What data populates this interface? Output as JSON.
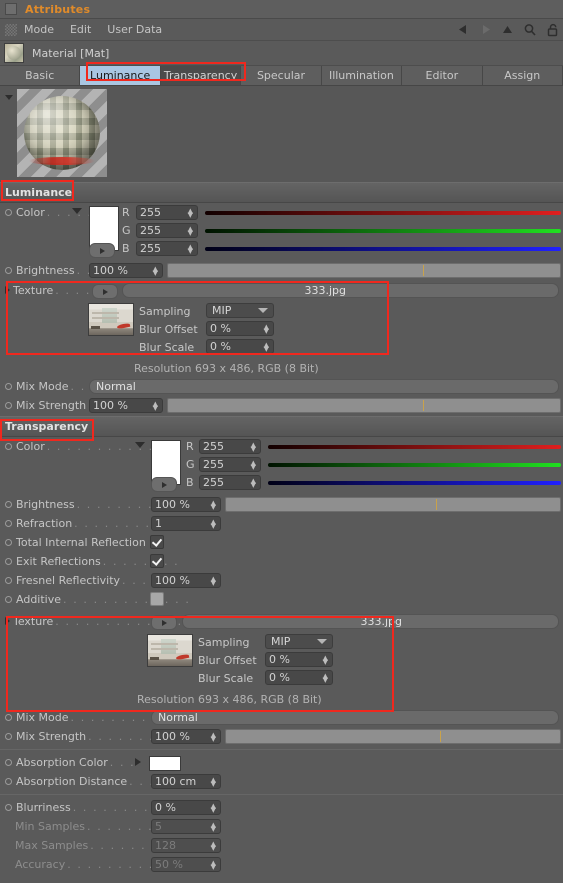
{
  "window": {
    "title": "Attributes",
    "menu": [
      "Mode",
      "Edit",
      "User Data"
    ],
    "toolbar_icons": [
      "prev-arrow-icon",
      "next-arrow-icon",
      "up-arrow-icon",
      "search-icon",
      "lock-icon"
    ]
  },
  "object": {
    "name": "Material [Mat]"
  },
  "tabs": [
    {
      "label": "Basic",
      "state": "normal"
    },
    {
      "label": "Luminance",
      "state": "selected"
    },
    {
      "label": "Transparency",
      "state": "dark"
    },
    {
      "label": "Specular",
      "state": "normal"
    },
    {
      "label": "Illumination",
      "state": "normal"
    },
    {
      "label": "Editor",
      "state": "normal"
    },
    {
      "label": "Assign",
      "state": "normal"
    }
  ],
  "luminance": {
    "header": "Luminance",
    "color": {
      "label": "Color",
      "dots": ". . . . .",
      "r_label": "R",
      "r_value": "255",
      "g_label": "G",
      "g_value": "255",
      "b_label": "B",
      "b_value": "255"
    },
    "brightness": {
      "label": "Brightness",
      "dots": ". .",
      "value": "100 %"
    },
    "texture": {
      "label": "Texture",
      "dots": ". . . . .",
      "filename": "333.jpg",
      "sampling_label": "Sampling",
      "sampling_value": "MIP",
      "blur_offset_label": "Blur Offset",
      "blur_offset_value": "0 %",
      "blur_scale_label": "Blur Scale",
      "blur_scale_value": "0 %",
      "resolution": "Resolution 693 x 486, RGB (8 Bit)"
    },
    "mix_mode": {
      "label": "Mix Mode",
      "dots": ". . .",
      "value": "Normal"
    },
    "mix_strength": {
      "label": "Mix Strength",
      "value": "100 %"
    }
  },
  "transparency": {
    "header": "Transparency",
    "color": {
      "label": "Color",
      "dots": ". . . . . . . . . . . . .",
      "r_label": "R",
      "r_value": "255",
      "g_label": "G",
      "g_value": "255",
      "b_label": "B",
      "b_value": "255"
    },
    "brightness": {
      "label": "Brightness",
      "dots": ". . . . . . . . . . .",
      "value": "100 %"
    },
    "refraction": {
      "label": "Refraction",
      "dots": ". . . . . . . . . . . .",
      "value": "1"
    },
    "total_internal_reflection": {
      "label": "Total Internal Reflection",
      "checked": true
    },
    "exit_reflections": {
      "label": "Exit Reflections",
      "dots": ". . . . . . . .",
      "checked": true
    },
    "fresnel_reflectivity": {
      "label": "Fresnel Reflectivity",
      "dots": ". . . . .",
      "value": "100 %"
    },
    "additive": {
      "label": "Additive",
      "dots": ". . . . . . . . . . . . .",
      "checked": false
    },
    "texture": {
      "label": "Texture",
      "dots": ". . . . . . . . . . . . . . .",
      "filename": "333.jpg",
      "sampling_label": "Sampling",
      "sampling_value": "MIP",
      "blur_offset_label": "Blur Offset",
      "blur_offset_value": "0 %",
      "blur_scale_label": "Blur Scale",
      "blur_scale_value": "0 %",
      "resolution": "Resolution 693 x 486, RGB (8 Bit)"
    },
    "mix_mode": {
      "label": "Mix Mode",
      "dots": ". . . . . . . . . . . .",
      "value": "Normal"
    },
    "mix_strength": {
      "label": "Mix Strength",
      "dots": ". . . . . . . . . .",
      "value": "100 %"
    },
    "absorption_color": {
      "label": "Absorption Color",
      "dots": ". . ."
    },
    "absorption_distance": {
      "label": "Absorption Distance",
      "dots": ". . .",
      "value": "100 cm"
    },
    "blurriness": {
      "label": "Blurriness",
      "dots": ". . . . . . . . . . . .",
      "value": "0 %"
    },
    "min_samples": {
      "label": "Min Samples",
      "dots": ". . . . . . . . . .",
      "value": "5"
    },
    "max_samples": {
      "label": "Max Samples",
      "dots": ". . . . . . . . . .",
      "value": "128"
    },
    "accuracy": {
      "label": "Accuracy",
      "dots": ". . . . . . . . . . . . .",
      "value": "50 %"
    }
  },
  "colors": {
    "highlight": "#f0281e",
    "accent_title": "#e08b2a",
    "tab_selected_bg": "#a9c6e2",
    "panel_bg": "#5a5a5a"
  }
}
